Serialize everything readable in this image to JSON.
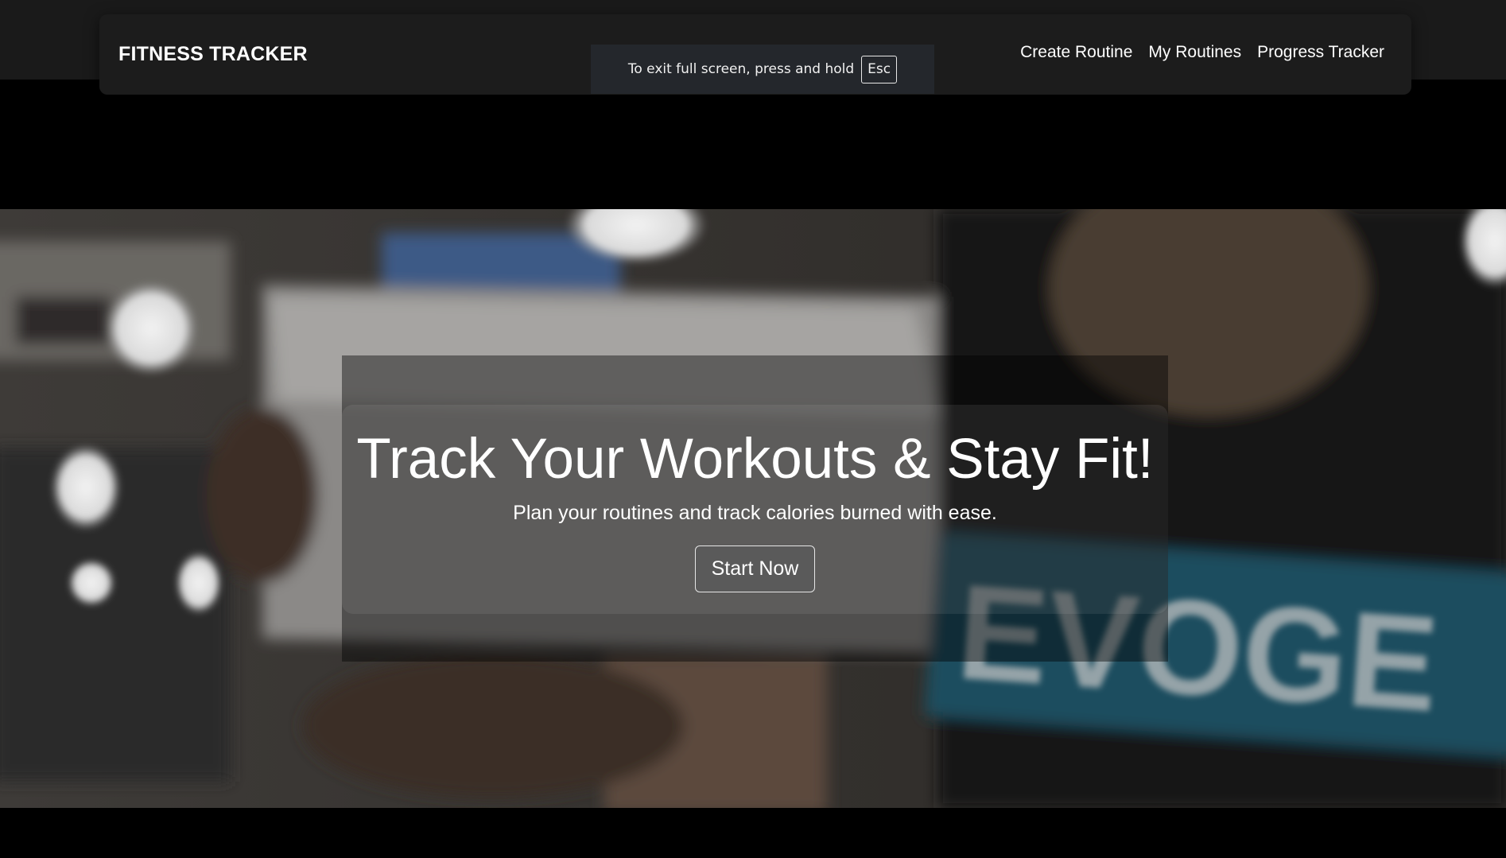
{
  "navbar": {
    "brand": "FITNESS TRACKER",
    "links": [
      {
        "label": "Create Routine"
      },
      {
        "label": "My Routines"
      },
      {
        "label": "Progress Tracker"
      }
    ]
  },
  "fullscreen_notice": {
    "text": "To exit full screen, press and hold",
    "key": "Esc"
  },
  "hero": {
    "background_description_icon": "gym-video-background",
    "title": "Track Your Workouts & Stay Fit!",
    "subtitle": "Plan your routines and track calories burned with ease.",
    "cta_label": "Start Now",
    "shirt_text": "EVOGE"
  },
  "colors": {
    "page_bg": "#000000",
    "navbar_bg": "#1c1c1c",
    "notice_bg": "#24272c",
    "button_bg": "#5a5a5a"
  }
}
